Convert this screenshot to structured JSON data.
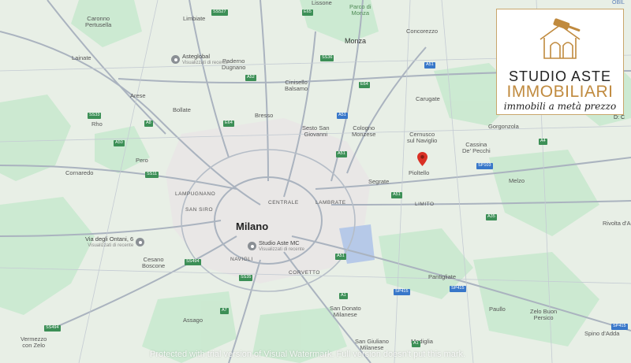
{
  "map": {
    "labels": {
      "caronno": "Caronno\nPertusella",
      "limbiate": "Limbiate",
      "lissone": "Lissone",
      "parco_monza": "Parco di\nMonza",
      "monza": "Monza",
      "concorezzo": "Concorezzo",
      "lainate": "Lainate",
      "paderno": "Paderno\nDugnano",
      "cinisello": "Cinisello\nBalsamo",
      "arese": "Arese",
      "bollate": "Bollate",
      "rho": "Rho",
      "bresso": "Bresso",
      "sesto": "Sesto San\nGiovanni",
      "cologno": "Cologno\nMonzese",
      "cernusco": "Cernusco\nsul Naviglio",
      "carugate": "Carugate",
      "gorgonzola": "Gorgonzola",
      "cassina": "Cassina\nDe' Pecchi",
      "pero": "Pero",
      "cornaredo": "Cornaredo",
      "pioltello": "Pioltello",
      "segrate": "Segrate",
      "melzo": "Melzo",
      "limito": "LIMITO",
      "lampugnano": "LAMPUGNANO",
      "san_siro": "SAN SIRO",
      "centrale": "CENTRALE",
      "lambrate": "LAMBRATE",
      "milano": "Milano",
      "navigli": "NAVIGLI",
      "corvetto": "CORVETTO",
      "cesano": "Cesano\nBoscone",
      "pantigliate": "Pantigliate",
      "assago": "Assago",
      "san_donato": "San Donato\nMilanese",
      "paullo": "Paullo",
      "zelo": "Zelo Buon\nPersico",
      "vermezzo": "Vermezzo\ncon Zelo",
      "san_giuliano": "San Giuliano\nMilanese",
      "mediglia": "Mediglia",
      "spino": "Spino d'Adda",
      "rivolta": "Rivolta d'Ad"
    },
    "pois": {
      "asteglobal": {
        "name": "Asteglobal",
        "sub": "Visualizzati di recente"
      },
      "studio_aste_mc": {
        "name": "Studio Aste MC",
        "sub": "Visualizzati di recente"
      },
      "via_ontani": {
        "name": "Via degli Ontani, 6",
        "sub": "Visualizzati di recente"
      }
    },
    "shields": {
      "ss527": "SS527",
      "e65": "E65",
      "ss36": "SS36",
      "a51": "A51",
      "e64": "E64",
      "ss33": "SS33",
      "a8": "A8",
      "a52": "A52",
      "a50": "A50",
      "ss11": "SS11",
      "sp103": "SP103",
      "a35": "A35",
      "ss494": "SS494",
      "ss35": "SS35",
      "a1": "A1",
      "a7": "A7",
      "sp415": "SP415",
      "a4": "A4"
    },
    "corner_text": "D: C",
    "top_corner_text": "OBIL"
  },
  "logo": {
    "line1": "STUDIO ASTE",
    "line2": "IMMOBILIARI",
    "line3": "immobili a metà prezzo",
    "gold": "#c08a3e"
  },
  "pin": {
    "color": "#d93025",
    "icon": "map-pin-icon"
  },
  "watermark": "Protected with trial version of Visual Watermark. Full version doesn't put this mark."
}
